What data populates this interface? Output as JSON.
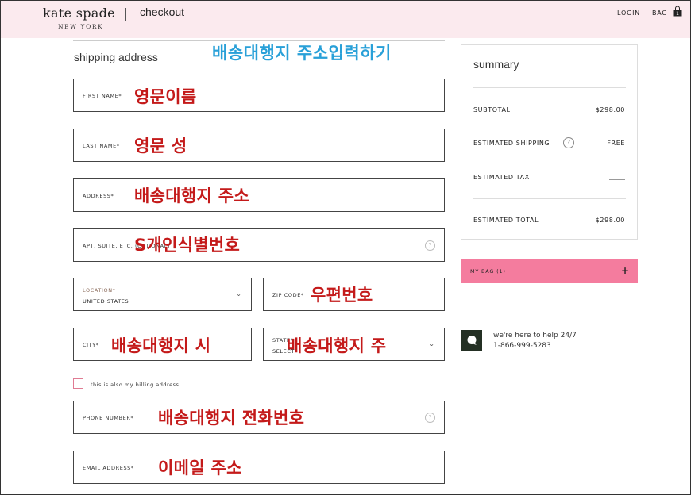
{
  "header": {
    "brand": "kate spade",
    "brand_sub": "NEW YORK",
    "page": "checkout",
    "login": "LOGIN",
    "bag": "BAG",
    "bag_count": "1"
  },
  "shipping": {
    "title": "shipping address",
    "annotation": "배송대행지 주소입력하기",
    "fields": {
      "first_name": {
        "label": "FIRST NAME*",
        "annotation": "영문이름"
      },
      "last_name": {
        "label": "LAST NAME*",
        "annotation": "영문 성"
      },
      "address": {
        "label": "ADDRESS*",
        "annotation": "배송대행지 주소"
      },
      "apt": {
        "label": "APT, SUITE, ETC. (OPTIONAL)",
        "annotation": "S개인식별번호"
      },
      "location": {
        "label": "LOCATION*",
        "value": "UNITED STATES"
      },
      "zip": {
        "label": "ZIP CODE*",
        "annotation": "우편번호"
      },
      "city": {
        "label": "CITY*",
        "annotation": "배송대행지 시"
      },
      "state": {
        "label": "STATE*",
        "value": "SELECT",
        "annotation": "배송대행지 주"
      },
      "phone": {
        "label": "PHONE NUMBER*",
        "annotation": "배송대행지 전화번호"
      },
      "email": {
        "label": "EMAIL ADDRESS*",
        "annotation": "이메일 주소"
      }
    },
    "billing_checkbox_label": "this is also my billing address"
  },
  "summary": {
    "title": "summary",
    "subtotal_label": "SUBTOTAL",
    "subtotal": "$298.00",
    "shipping_label": "ESTIMATED SHIPPING",
    "shipping": "FREE",
    "tax_label": "ESTIMATED TAX",
    "total_label": "ESTIMATED TOTAL",
    "total": "$298.00"
  },
  "mybag": {
    "label": "MY BAG (1)",
    "toggle": "+"
  },
  "help": {
    "line1": "we're here to help 24/7",
    "phone": "1-866-999-5283"
  },
  "colors": {
    "header_bg": "#fbeaee",
    "annotation_red": "#c41a1a",
    "annotation_blue": "#28a0d8",
    "mybag_bg": "#f47c9e"
  }
}
